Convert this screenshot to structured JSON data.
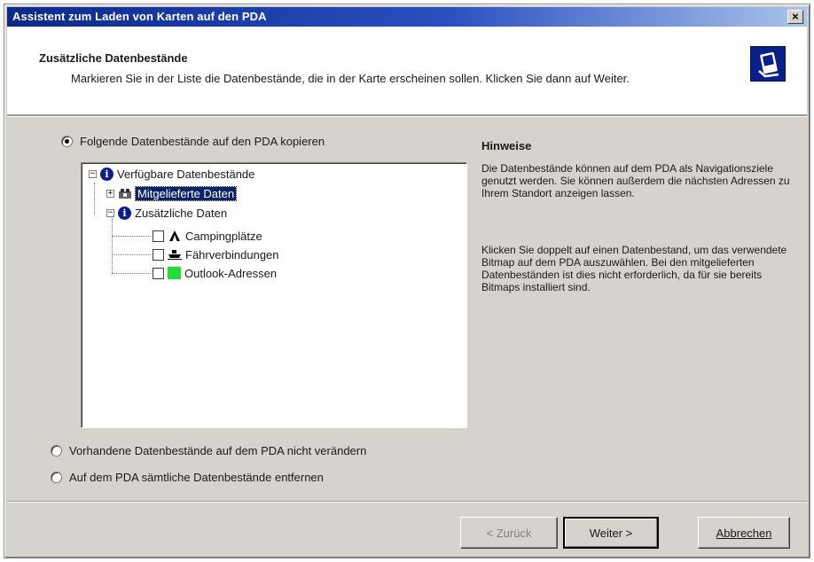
{
  "window": {
    "title": "Assistent zum Laden von Karten auf den PDA",
    "close_label": "×"
  },
  "header": {
    "title": "Zusätzliche Datenbestände",
    "description": "Markieren Sie in der Liste die Datenbestände, die in der Karte erscheinen sollen. Klicken Sie dann auf Weiter."
  },
  "options": {
    "copy_label": "Folgende Datenbestände auf den PDA kopieren",
    "keep_label": "Vorhandene Datenbestände auf dem PDA nicht verändern",
    "remove_label": "Auf dem PDA sämtliche Datenbestände entfernen",
    "selected": "copy"
  },
  "tree": {
    "root": "Verfügbare Datenbestände",
    "supplied": "Mitgelieferte Daten",
    "additional": "Zusätzliche Daten",
    "items": [
      {
        "label": "Campingplätze",
        "icon": "tent-icon",
        "checked": false
      },
      {
        "label": "Fährverbindungen",
        "icon": "ferry-icon",
        "checked": false
      },
      {
        "label": "Outlook-Adressen",
        "icon": "green-square-icon",
        "checked": false
      }
    ]
  },
  "hints": {
    "title": "Hinweise",
    "paragraph1": "Die Datenbestände können auf dem PDA als Navigationsziele genutzt werden. Sie können außerdem die nächsten Adressen zu Ihrem Standort anzeigen lassen.",
    "paragraph2": "Klicken Sie doppelt auf einen Datenbestand, um das verwendete Bitmap auf dem PDA auszuwählen. Bei den mitgelieferten Datenbeständen ist dies nicht erforderlich, da für sie bereits Bitmaps installiert sind."
  },
  "buttons": {
    "back": "< Zurück",
    "next": "Weiter >",
    "cancel": "Abbrechen"
  },
  "colors": {
    "accent": "#0a246a",
    "title_gradient_start": "#0b2a8a",
    "outlook_green": "#22dd33"
  }
}
